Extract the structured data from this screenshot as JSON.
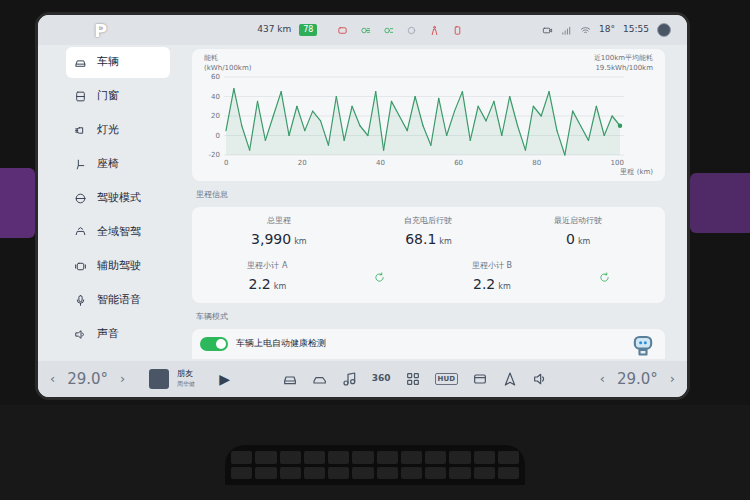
{
  "status_bar": {
    "gear": "P",
    "range": "437 km",
    "battery": "78",
    "temperature": "18°",
    "time": "15:55"
  },
  "sidebar": {
    "items": [
      {
        "label": "车辆",
        "selected": true
      },
      {
        "label": "门窗",
        "selected": false
      },
      {
        "label": "灯光",
        "selected": false
      },
      {
        "label": "座椅",
        "selected": false
      },
      {
        "label": "驾驶模式",
        "selected": false
      },
      {
        "label": "全域智驾",
        "selected": false
      },
      {
        "label": "辅助驾驶",
        "selected": false
      },
      {
        "label": "智能语音",
        "selected": false
      },
      {
        "label": "声音",
        "selected": false
      }
    ]
  },
  "chart": {
    "y_label": "能耗",
    "y_unit": "(kWh/100km)",
    "y_ticks": [
      "60",
      "40",
      "20",
      "0",
      "-20"
    ],
    "x_ticks": [
      "0",
      "20",
      "40",
      "60",
      "80",
      "100"
    ],
    "x_label": "里程 (km)",
    "legend_title": "近100km平均能耗",
    "legend_value": "19.5kWh/100km",
    "series": [
      {
        "values": [
          5,
          48,
          10,
          -15,
          35,
          -5,
          20,
          45,
          0,
          30,
          5,
          25,
          15,
          -10,
          40,
          -5,
          30,
          10,
          0,
          45,
          -15,
          35,
          20,
          5,
          40,
          10,
          -10,
          38,
          0,
          25,
          45,
          -5,
          30,
          15,
          35,
          0,
          40,
          10,
          -15,
          30,
          20,
          45,
          5,
          -20,
          25,
          10,
          -5,
          30,
          0,
          20,
          10
        ]
      }
    ]
  },
  "mileage": {
    "title": "里程信息",
    "items": [
      {
        "label": "总里程",
        "value": "3,990",
        "unit": "km"
      },
      {
        "label": "自充电后行驶",
        "value": "68.1",
        "unit": "km"
      },
      {
        "label": "最近启动行驶",
        "value": "0",
        "unit": "km"
      }
    ],
    "trips": [
      {
        "label": "里程小计 A",
        "value": "2.2",
        "unit": "km"
      },
      {
        "label": "里程小计 B",
        "value": "2.2",
        "unit": "km"
      }
    ]
  },
  "vehicle_mode": {
    "title": "车辆模式",
    "toggles": [
      {
        "label": "车辆上电自动健康检测",
        "on": true
      }
    ]
  },
  "bottom_bar": {
    "left_prev": "‹",
    "left_temp": "29.0°",
    "left_next": "›",
    "media": {
      "title": "朋友",
      "artist": "周华健",
      "play": "▶"
    },
    "view_label": "360",
    "hud_label": "HUD",
    "right_prev": "‹",
    "right_temp": "29.0°",
    "right_next": "›"
  }
}
